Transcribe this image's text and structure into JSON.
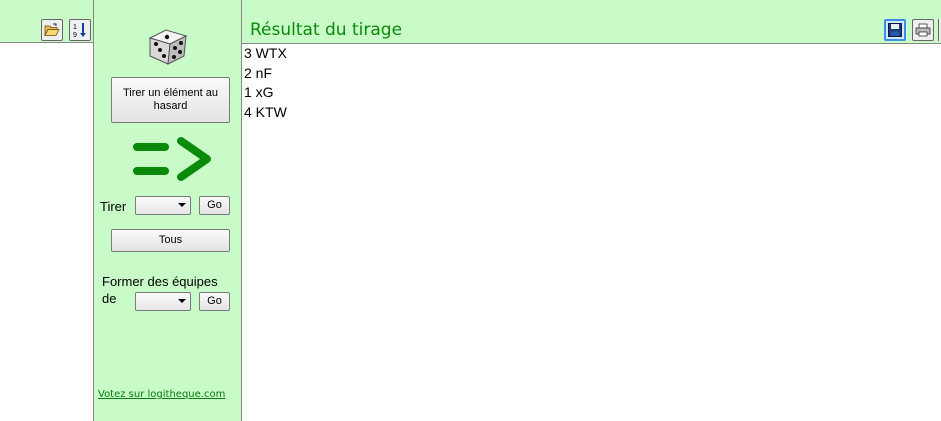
{
  "toolbar": {
    "open_icon": "folder-open-icon",
    "sort_icon": "sort-numeric-icon",
    "save_icon": "save-icon",
    "print_icon": "print-icon"
  },
  "result": {
    "title": "Résultat du tirage",
    "lines": [
      "3 WTX",
      "2 nF",
      "1 xG",
      "4 KTW"
    ]
  },
  "panel": {
    "draw_one_label": "Tirer un élément au hasard",
    "draw_label": "Tirer",
    "draw_value": "",
    "go_label": "Go",
    "all_label": "Tous",
    "teams_label_line1": "Former des équipes",
    "teams_label_line2": "de",
    "teams_value": "",
    "teams_go_label": "Go",
    "vote_link": "Votez sur logitheque.com"
  },
  "colors": {
    "background": "#c8fbc8",
    "accent_green": "#0a8a0a"
  }
}
